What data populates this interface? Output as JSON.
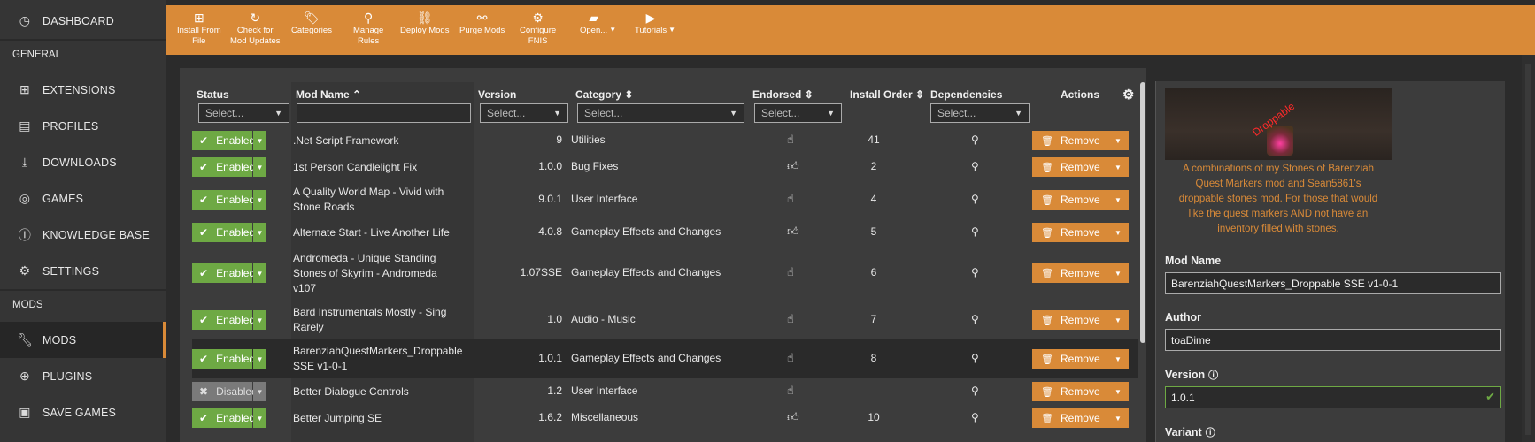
{
  "sidebar": {
    "dashboard": "DASHBOARD",
    "general_header": "GENERAL",
    "extensions": "EXTENSIONS",
    "profiles": "PROFILES",
    "downloads": "DOWNLOADS",
    "games": "GAMES",
    "knowledge_base": "KNOWLEDGE BASE",
    "settings": "SETTINGS",
    "mods_header": "MODS",
    "mods": "MODS",
    "plugins": "PLUGINS",
    "save_games": "SAVE GAMES"
  },
  "toolbar": {
    "install_from_file_1": "Install From",
    "install_from_file_2": "File",
    "check_updates_1": "Check for",
    "check_updates_2": "Mod Updates",
    "categories": "Categories",
    "manage_rules_1": "Manage",
    "manage_rules_2": "Rules",
    "deploy_mods": "Deploy Mods",
    "purge_mods": "Purge Mods",
    "configure_fnis_1": "Configure",
    "configure_fnis_2": "FNIS",
    "open": "Open...",
    "tutorials": "Tutorials"
  },
  "table": {
    "headers": {
      "status": "Status",
      "mod_name": "Mod Name",
      "version": "Version",
      "category": "Category",
      "endorsed": "Endorsed",
      "install_order": "Install Order",
      "dependencies": "Dependencies",
      "actions": "Actions"
    },
    "filter_placeholder": "Select...",
    "remove_label": "Remove",
    "rows": [
      {
        "status": "Enabled",
        "name_1": ".Net Script Framework",
        "name_2": "",
        "name_3": "",
        "version": "9",
        "category": "Utilities",
        "endorsed": "no",
        "order": "41"
      },
      {
        "status": "Enabled",
        "name_1": "1st Person Candlelight Fix",
        "name_2": "",
        "name_3": "",
        "version": "1.0.0",
        "category": "Bug Fixes",
        "endorsed": "yes",
        "order": "2"
      },
      {
        "status": "Enabled",
        "name_1": "A Quality World Map - Vivid with",
        "name_2": "Stone Roads",
        "name_3": "",
        "version": "9.0.1",
        "category": "User Interface",
        "endorsed": "no",
        "order": "4"
      },
      {
        "status": "Enabled",
        "name_1": "Alternate Start - Live Another Life",
        "name_2": "",
        "name_3": "",
        "version": "4.0.8",
        "category": "Gameplay Effects and Changes",
        "endorsed": "yes",
        "order": "5"
      },
      {
        "status": "Enabled",
        "name_1": "Andromeda - Unique Standing",
        "name_2": "Stones of Skyrim - Andromeda",
        "name_3": "v107",
        "version": "1.07SSE",
        "category": "Gameplay Effects and Changes",
        "endorsed": "no",
        "order": "6"
      },
      {
        "status": "Enabled",
        "name_1": "Bard Instrumentals Mostly - Sing",
        "name_2": "Rarely",
        "name_3": "",
        "version": "1.0",
        "category": "Audio - Music",
        "endorsed": "no",
        "order": "7"
      },
      {
        "status": "Enabled",
        "name_1": "BarenziahQuestMarkers_Droppable",
        "name_2": "SSE v1-0-1",
        "name_3": "",
        "version": "1.0.1",
        "category": "Gameplay Effects and Changes",
        "endorsed": "no",
        "order": "8"
      },
      {
        "status": "Disabled",
        "name_1": "Better Dialogue Controls",
        "name_2": "",
        "name_3": "",
        "version": "1.2",
        "category": "User Interface",
        "endorsed": "no",
        "order": ""
      },
      {
        "status": "Enabled",
        "name_1": "Better Jumping SE",
        "name_2": "",
        "name_3": "",
        "version": "1.6.2",
        "category": "Miscellaneous",
        "endorsed": "yes",
        "order": "10"
      }
    ]
  },
  "details": {
    "watermark": "Droppable",
    "description_1": "A combinations of my Stones of Barenziah",
    "description_2": "Quest Markers mod and Sean5861's",
    "description_3": "droppable stones mod. For those that would",
    "description_4": "like the quest markers AND not have an",
    "description_5": "inventory filled with stones.",
    "mod_name_label": "Mod Name",
    "mod_name_value": "BarenziahQuestMarkers_Droppable SSE v1-0-1",
    "author_label": "Author",
    "author_value": "toaDime",
    "version_label": "Version",
    "version_value": "1.0.1",
    "variant_label": "Variant"
  },
  "colors": {
    "accent": "#d98a38",
    "enabled": "#6ea944",
    "disabled": "#7a7a7a",
    "sidebar": "#353535",
    "panel": "#3c3c3c"
  }
}
